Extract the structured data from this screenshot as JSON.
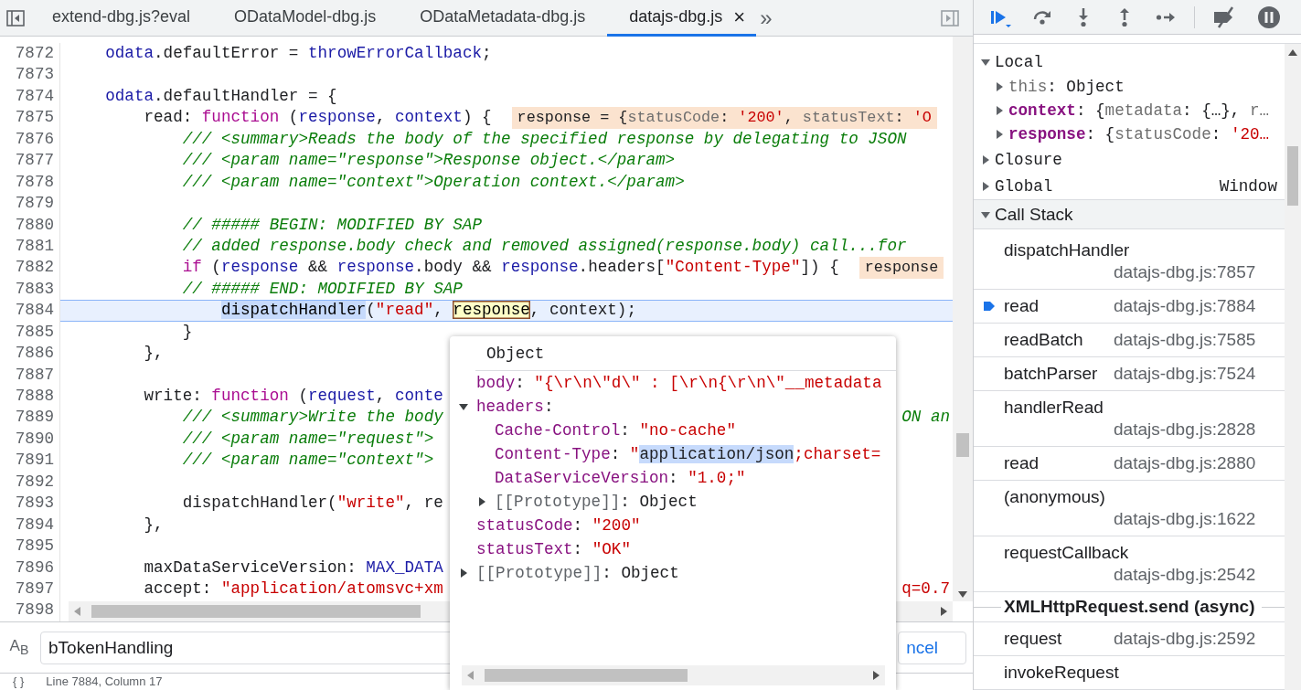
{
  "tabs": [
    {
      "label": "extend-dbg.js?eval",
      "selected": false
    },
    {
      "label": "ODataModel-dbg.js",
      "selected": false
    },
    {
      "label": "ODataMetadata-dbg.js",
      "selected": false
    },
    {
      "label": "datajs-dbg.js",
      "selected": true,
      "close": "×"
    }
  ],
  "tab_overflow": "»",
  "code": {
    "lines": [
      {
        "children": [
          {
            "number": "7872",
            "tokens": [
              {
                "kind": "var",
                "text": "odata"
              },
              {
                "kind": "plain",
                "text": ".defaultError = "
              },
              {
                "kind": "var",
                "text": "throwErrorCallback"
              },
              {
                "kind": "plain",
                "text": ";"
              }
            ],
            "current": false
          },
          {
            "number": "7873",
            "current": false
          },
          {
            "number": "7874",
            "tokens": [
              {
                "kind": "var",
                "text": "odata"
              },
              {
                "kind": "plain",
                "text": ".defaultHandler = {"
              }
            ],
            "current": false
          },
          {
            "children": [
              {
                "number": "7875",
                "tokens": [
                  {
                    "kind": "plain",
                    "text": "read: "
                  },
                  {
                    "kind": "kw",
                    "text": "function"
                  },
                  {
                    "kind": "plain",
                    "text": " ("
                  },
                  {
                    "kind": "var",
                    "text": "response"
                  },
                  {
                    "kind": "plain",
                    "text": ", "
                  },
                  {
                    "kind": "var",
                    "text": "context"
                  },
                  {
                    "kind": "plain",
                    "text": ") {"
                  }
                ],
                "badge": [
                  {
                    "kind": "plain",
                    "text": "response = {"
                  },
                  {
                    "kind": "grey",
                    "text": "statusCode"
                  },
                  {
                    "kind": "plain",
                    "text": ": "
                  },
                  {
                    "kind": "str",
                    "text": "'200'"
                  },
                  {
                    "kind": "plain",
                    "text": ", "
                  },
                  {
                    "kind": "grey",
                    "text": "statusText"
                  },
                  {
                    "kind": "plain",
                    "text": ": "
                  },
                  {
                    "kind": "str",
                    "text": "'O"
                  }
                ],
                "current": false
              },
              {
                "children": [
                  {
                    "number": "7876",
                    "tokens": [
                      {
                        "kind": "com",
                        "text": "/// <summary>Reads the body of the specified response by delegating to JSON"
                      }
                    ],
                    "current": false
                  },
                  {
                    "number": "7877",
                    "tokens": [
                      {
                        "kind": "com",
                        "text": "/// <param name=\"response\">Response object.</param>"
                      }
                    ],
                    "current": false
                  },
                  {
                    "number": "7878",
                    "tokens": [
                      {
                        "kind": "com",
                        "text": "/// <param name=\"context\">Operation context.</param>"
                      }
                    ],
                    "current": false
                  },
                  {
                    "number": "7879",
                    "current": false
                  },
                  {
                    "number": "7880",
                    "tokens": [
                      {
                        "kind": "com",
                        "text": "// ##### BEGIN: MODIFIED BY SAP"
                      }
                    ],
                    "current": false
                  },
                  {
                    "number": "7881",
                    "tokens": [
                      {
                        "kind": "com",
                        "text": "// added response.body check and removed assigned(response.body) call...for"
                      }
                    ],
                    "current": false
                  },
                  {
                    "number": "7882",
                    "tokens": [
                      {
                        "kind": "kw",
                        "text": "if"
                      },
                      {
                        "kind": "plain",
                        "text": " ("
                      },
                      {
                        "kind": "var",
                        "text": "response"
                      },
                      {
                        "kind": "plain",
                        "text": " && "
                      },
                      {
                        "kind": "var",
                        "text": "response"
                      },
                      {
                        "kind": "plain",
                        "text": ".body && "
                      },
                      {
                        "kind": "var",
                        "text": "response"
                      },
                      {
                        "kind": "plain",
                        "text": ".headers["
                      },
                      {
                        "kind": "str",
                        "text": "\"Content-Type\""
                      },
                      {
                        "kind": "plain",
                        "text": "]) {"
                      }
                    ],
                    "badge": [
                      {
                        "kind": "plain",
                        "text": "response"
                      }
                    ],
                    "current": false
                  },
                  {
                    "number": "7883",
                    "tokens": [
                      {
                        "kind": "com",
                        "text": "// ##### END: MODIFIED BY SAP"
                      }
                    ],
                    "current": false
                  },
                  {
                    "children": [
                      {
                        "number": "7884",
                        "tokens": [
                          {
                            "kind": "sel",
                            "text": "dispatchHandler"
                          },
                          {
                            "kind": "plain",
                            "text": "("
                          },
                          {
                            "kind": "str",
                            "text": "\"read\""
                          },
                          {
                            "kind": "plain",
                            "text": ", "
                          },
                          {
                            "kind": "hover",
                            "text": "response"
                          },
                          {
                            "kind": "plain",
                            "text": ", context);"
                          }
                        ],
                        "current": true
                      }
                    ]
                  },
                  {
                    "number": "7885",
                    "tokens": [
                      {
                        "kind": "plain",
                        "text": "}"
                      }
                    ],
                    "current": false
                  }
                ]
              },
              {
                "number": "7886",
                "tokens": [
                  {
                    "kind": "plain",
                    "text": "},"
                  }
                ],
                "current": false
              },
              {
                "number": "7887",
                "current": false
              },
              {
                "number": "7888",
                "tokens": [
                  {
                    "kind": "plain",
                    "text": "write: "
                  },
                  {
                    "kind": "kw",
                    "text": "function"
                  },
                  {
                    "kind": "plain",
                    "text": " ("
                  },
                  {
                    "kind": "var",
                    "text": "request"
                  },
                  {
                    "kind": "plain",
                    "text": ", "
                  },
                  {
                    "kind": "var",
                    "text": "conte"
                  }
                ],
                "current": false
              },
              {
                "children": [
                  {
                    "number": "7889",
                    "tokens": [
                      {
                        "kind": "com",
                        "text": "/// <summary>Write the body"
                      }
                    ],
                    "right": [
                      {
                        "kind": "com",
                        "text": "ON an"
                      }
                    ],
                    "current": false
                  },
                  {
                    "number": "7890",
                    "tokens": [
                      {
                        "kind": "com",
                        "text": "/// <param name=\"request\">"
                      }
                    ],
                    "current": false
                  },
                  {
                    "number": "7891",
                    "tokens": [
                      {
                        "kind": "com",
                        "text": "/// <param name=\"context\">"
                      }
                    ],
                    "current": false
                  },
                  {
                    "number": "7892",
                    "current": false
                  },
                  {
                    "number": "7893",
                    "tokens": [
                      {
                        "kind": "plain",
                        "text": "dispatchHandler("
                      },
                      {
                        "kind": "str",
                        "text": "\"write\""
                      },
                      {
                        "kind": "plain",
                        "text": ", re"
                      }
                    ],
                    "current": false
                  }
                ]
              },
              {
                "number": "7894",
                "tokens": [
                  {
                    "kind": "plain",
                    "text": "},"
                  }
                ],
                "current": false
              },
              {
                "number": "7895",
                "current": false
              },
              {
                "number": "7896",
                "tokens": [
                  {
                    "kind": "plain",
                    "text": "maxDataServiceVersion: "
                  },
                  {
                    "kind": "var",
                    "text": "MAX_DATA"
                  }
                ],
                "current": false
              },
              {
                "number": "7897",
                "tokens": [
                  {
                    "kind": "plain",
                    "text": "accept: "
                  },
                  {
                    "kind": "str",
                    "text": "\"application/atomsvc+xm"
                  }
                ],
                "right": [
                  {
                    "kind": "str",
                    "text": "q=0.7"
                  }
                ],
                "current": false
              }
            ]
          }
        ]
      },
      {
        "number": "7898",
        "current": false
      }
    ]
  },
  "search": {
    "case_toggle": "A$_{B}$",
    "value": "bTokenHandling",
    "cancel_button": "ncel"
  },
  "status_bar": {
    "pretty_print": "{ }",
    "position": "Line 7884, Column 17"
  },
  "popup": {
    "title": "Object",
    "rows": [
      {
        "tokens": [
          {
            "kind": "key",
            "text": "body"
          },
          {
            "kind": "plain",
            "text": ": "
          },
          {
            "kind": "str",
            "text": "\"{\\r\\n\\\"d\\\" : [\\r\\n{\\r\\n\\\"__metadata"
          }
        ]
      },
      {
        "tokens": [
          {
            "kind": "key",
            "text": "headers"
          },
          {
            "kind": "plain",
            "text": ":"
          }
        ],
        "expanded": true,
        "children": [
          {
            "tokens": [
              {
                "kind": "key",
                "text": "Cache-Control"
              },
              {
                "kind": "plain",
                "text": ": "
              },
              {
                "kind": "str",
                "text": "\"no-cache\""
              }
            ]
          },
          {
            "tokens": [
              {
                "kind": "key",
                "text": "Content-Type"
              },
              {
                "kind": "plain",
                "text": ": "
              },
              {
                "kind": "str",
                "text": "\""
              },
              {
                "kind": "sel",
                "text": "application/json"
              },
              {
                "kind": "str",
                "text": ";charset="
              }
            ]
          },
          {
            "tokens": [
              {
                "kind": "key",
                "text": "DataServiceVersion"
              },
              {
                "kind": "plain",
                "text": ": "
              },
              {
                "kind": "str",
                "text": "\"1.0;\""
              }
            ]
          },
          {
            "tokens": [
              {
                "kind": "internal",
                "text": "[[Prototype]]"
              },
              {
                "kind": "plain",
                "text": ": Object"
              }
            ],
            "expanded": false
          }
        ]
      },
      {
        "tokens": [
          {
            "kind": "key",
            "text": "statusCode"
          },
          {
            "kind": "plain",
            "text": ": "
          },
          {
            "kind": "str",
            "text": "\"200\""
          }
        ]
      },
      {
        "tokens": [
          {
            "kind": "key",
            "text": "statusText"
          },
          {
            "kind": "plain",
            "text": ": "
          },
          {
            "kind": "str",
            "text": "\"OK\""
          }
        ]
      },
      {
        "tokens": [
          {
            "kind": "internal",
            "text": "[[Prototype]]"
          },
          {
            "kind": "plain",
            "text": ": Object"
          }
        ],
        "expanded": false
      }
    ]
  },
  "scope": [
    {
      "tokens": [
        {
          "kind": "plain",
          "text": "Local"
        }
      ],
      "expanded": true,
      "children": [
        {
          "tokens": [
            {
              "kind": "grey",
              "text": "this"
            },
            {
              "kind": "plain",
              "text": ": Object"
            }
          ],
          "expanded": false
        },
        {
          "tokens": [
            {
              "kind": "keyb",
              "text": "context"
            },
            {
              "kind": "plain",
              "text": ": {"
            },
            {
              "kind": "grey",
              "text": "metadata"
            },
            {
              "kind": "plain",
              "text": ": {…}, "
            },
            {
              "kind": "grey",
              "text": "r…"
            }
          ],
          "expanded": false
        },
        {
          "tokens": [
            {
              "kind": "keyb",
              "text": "response"
            },
            {
              "kind": "plain",
              "text": ": {"
            },
            {
              "kind": "grey",
              "text": "statusCode"
            },
            {
              "kind": "plain",
              "text": ": "
            },
            {
              "kind": "str",
              "text": "'20…"
            }
          ],
          "expanded": false
        }
      ]
    },
    {
      "tokens": [
        {
          "kind": "plain",
          "text": "Closure"
        }
      ],
      "expanded": false
    },
    {
      "tokens": [
        {
          "kind": "plain",
          "text": "Global"
        }
      ],
      "expanded": false,
      "value": "Window"
    }
  ],
  "call_stack_title": "Call Stack",
  "call_stack": [
    {
      "kind": "frame",
      "name": "dispatchHandler",
      "location": "datajs-dbg.js:7857",
      "current": false
    },
    {
      "kind": "frame",
      "name": "read",
      "location": "datajs-dbg.js:7884",
      "current": true
    },
    {
      "kind": "frame",
      "name": "readBatch",
      "location": "datajs-dbg.js:7585",
      "current": false
    },
    {
      "kind": "frame",
      "name": "batchParser",
      "location": "datajs-dbg.js:7524",
      "current": false
    },
    {
      "kind": "frame",
      "name": "handlerRead",
      "location": "datajs-dbg.js:2828",
      "current": false
    },
    {
      "kind": "frame",
      "name": "read",
      "location": "datajs-dbg.js:2880",
      "current": false
    },
    {
      "kind": "frame",
      "name": "(anonymous)",
      "location": "datajs-dbg.js:1622",
      "current": false
    },
    {
      "kind": "frame",
      "name": "requestCallback",
      "location": "datajs-dbg.js:2542",
      "current": false
    },
    {
      "kind": "async",
      "name": "XMLHttpRequest.send (async)"
    },
    {
      "kind": "frame",
      "name": "request",
      "location": "datajs-dbg.js:2592",
      "current": false
    },
    {
      "kind": "frame",
      "name": "invokeRequest",
      "current": false
    }
  ]
}
